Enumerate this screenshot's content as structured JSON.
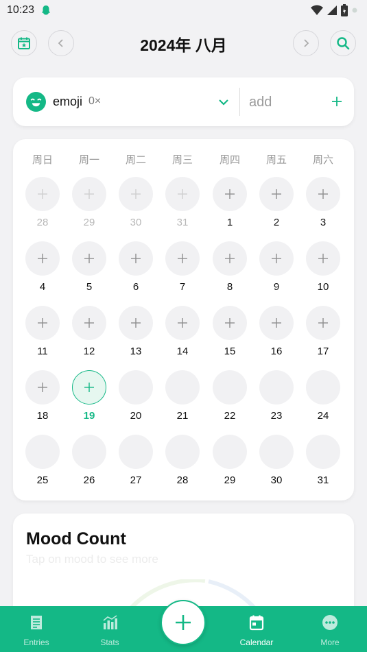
{
  "status_bar": {
    "time": "10:23"
  },
  "header": {
    "title": "2024年 八月"
  },
  "selector": {
    "emoji_label": "emoji",
    "count": "0×",
    "add_placeholder": "add"
  },
  "calendar": {
    "weekdays": [
      "周日",
      "周一",
      "周二",
      "周三",
      "周四",
      "周五",
      "周六"
    ],
    "days": [
      {
        "label": "28",
        "state": "faded",
        "plus": true
      },
      {
        "label": "29",
        "state": "faded",
        "plus": true
      },
      {
        "label": "30",
        "state": "faded",
        "plus": true
      },
      {
        "label": "31",
        "state": "faded",
        "plus": true
      },
      {
        "label": "1",
        "state": "normal",
        "plus": true
      },
      {
        "label": "2",
        "state": "normal",
        "plus": true
      },
      {
        "label": "3",
        "state": "normal",
        "plus": true
      },
      {
        "label": "4",
        "state": "normal",
        "plus": true
      },
      {
        "label": "5",
        "state": "normal",
        "plus": true
      },
      {
        "label": "6",
        "state": "normal",
        "plus": true
      },
      {
        "label": "7",
        "state": "normal",
        "plus": true
      },
      {
        "label": "8",
        "state": "normal",
        "plus": true
      },
      {
        "label": "9",
        "state": "normal",
        "plus": true
      },
      {
        "label": "10",
        "state": "normal",
        "plus": true
      },
      {
        "label": "11",
        "state": "normal",
        "plus": true
      },
      {
        "label": "12",
        "state": "normal",
        "plus": true
      },
      {
        "label": "13",
        "state": "normal",
        "plus": true
      },
      {
        "label": "14",
        "state": "normal",
        "plus": true
      },
      {
        "label": "15",
        "state": "normal",
        "plus": true
      },
      {
        "label": "16",
        "state": "normal",
        "plus": true
      },
      {
        "label": "17",
        "state": "normal",
        "plus": true
      },
      {
        "label": "18",
        "state": "normal",
        "plus": true
      },
      {
        "label": "19",
        "state": "today",
        "plus": true
      },
      {
        "label": "20",
        "state": "normal",
        "plus": false
      },
      {
        "label": "21",
        "state": "normal",
        "plus": false
      },
      {
        "label": "22",
        "state": "normal",
        "plus": false
      },
      {
        "label": "23",
        "state": "normal",
        "plus": false
      },
      {
        "label": "24",
        "state": "normal",
        "plus": false
      },
      {
        "label": "25",
        "state": "normal",
        "plus": false
      },
      {
        "label": "26",
        "state": "normal",
        "plus": false
      },
      {
        "label": "27",
        "state": "normal",
        "plus": false
      },
      {
        "label": "28",
        "state": "normal",
        "plus": false
      },
      {
        "label": "29",
        "state": "normal",
        "plus": false
      },
      {
        "label": "30",
        "state": "normal",
        "plus": false
      },
      {
        "label": "31",
        "state": "normal",
        "plus": false
      }
    ]
  },
  "mood_count": {
    "title": "Mood Count",
    "subtitle": "Tap on mood to see more"
  },
  "bottom_nav": {
    "items": [
      {
        "label": "Entries",
        "icon": "entries-icon",
        "active": false
      },
      {
        "label": "Stats",
        "icon": "stats-icon",
        "active": false
      },
      {
        "label": "Calendar",
        "icon": "calendar-icon",
        "active": true
      },
      {
        "label": "More",
        "icon": "more-icon",
        "active": false
      }
    ]
  },
  "colors": {
    "accent": "#14b886",
    "background": "#f2f2f4",
    "card": "#ffffff",
    "cell": "#f1f1f3"
  }
}
